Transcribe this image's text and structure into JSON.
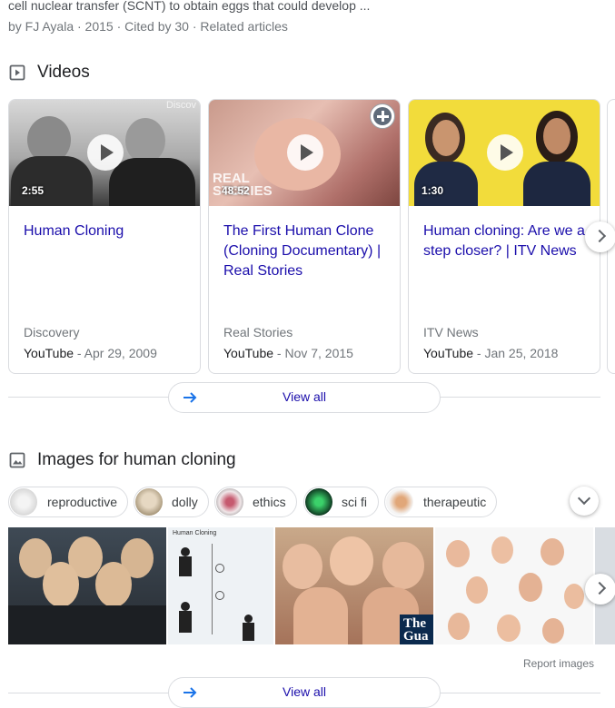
{
  "previous_result": {
    "snippet": "cell nuclear transfer (SCNT) to obtain eggs that could develop ...",
    "citation": "by FJ Ayala · 2015 · Cited by 30 · Related articles"
  },
  "videos": {
    "heading": "Videos",
    "items": [
      {
        "duration": "2:55",
        "title": "Human Cloning",
        "source": "Discovery",
        "platform": "YouTube",
        "date": "- Apr 29, 2009",
        "thumb_text": "Discov"
      },
      {
        "duration": "48:52",
        "title": "The First Human Clone (Cloning Documentary) | Real Stories",
        "source": "Real Stories",
        "platform": "YouTube",
        "date": "- Nov 7, 2015",
        "thumb_text": "REAL STORIES"
      },
      {
        "duration": "1:30",
        "title": "Human cloning: Are we a step closer? | ITV News",
        "source": "ITV News",
        "platform": "YouTube",
        "date": "- Jan 25, 2018"
      }
    ],
    "view_all": "View all"
  },
  "images": {
    "heading": "Images for human cloning",
    "chips": [
      "reproductive",
      "dolly",
      "ethics",
      "sci fi",
      "therapeutic"
    ],
    "thumb_text": {
      "diagram_title": "Human Cloning",
      "guardian": "The Gua"
    },
    "report": "Report images",
    "view_all": "View all"
  },
  "colors": {
    "link": "#1a0dab",
    "meta": "#70757a",
    "border": "#dadce0"
  }
}
